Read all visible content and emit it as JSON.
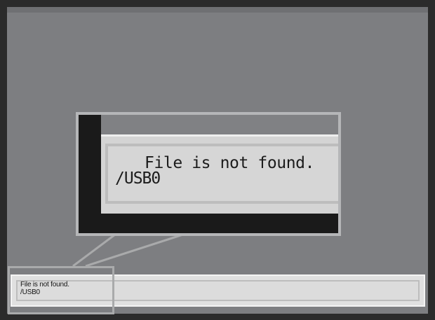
{
  "status_message": {
    "line1": "File is not found.",
    "line2": "/USB0"
  },
  "magnified_message": {
    "line1": "File is not found.",
    "line2": "/USB0"
  },
  "colors": {
    "screen_bg": "#7d7e81",
    "status_bar_bg": "#e0e0e0",
    "callout_border": "#a9aaab",
    "outer_frame": "#2b2b2b"
  }
}
